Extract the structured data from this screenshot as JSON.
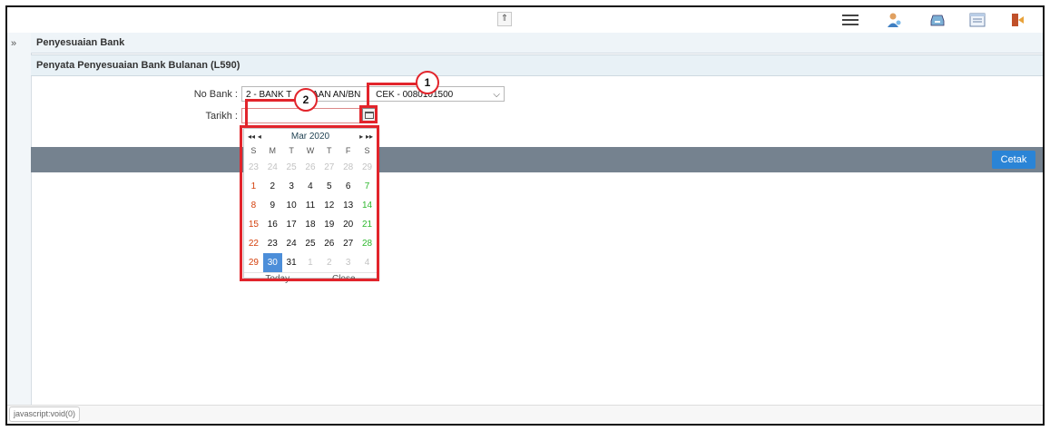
{
  "header": {
    "collapse_glyph": "⇑",
    "icons": [
      "menu-icon",
      "user-icon",
      "inbox-icon",
      "window-icon",
      "exit-icon"
    ]
  },
  "side_toggle_glyph": "»",
  "breadcrumb": {
    "title": "Penyesuaian Bank",
    "subtitle": "Penyata Penyesuaian Bank Bulanan (L590)"
  },
  "form": {
    "no_bank_label": "No Bank :",
    "no_bank_value": "2 - BANK T",
    "no_bank_value_tail": "AAN AN/BN",
    "no_bank_value_end": "CEK - 00801",
    "no_bank_value_last": "01500",
    "tarikh_label": "Tarikh :"
  },
  "action": {
    "cetak": "Cetak"
  },
  "calendar": {
    "month_label": "Mar 2020",
    "nav_prev_year": "◂◂",
    "nav_prev": "◂",
    "nav_next": "▸",
    "nav_next_year": "▸▸",
    "weekdays": [
      "S",
      "M",
      "T",
      "W",
      "T",
      "F",
      "S"
    ],
    "weeks": [
      [
        "23",
        "24",
        "25",
        "26",
        "27",
        "28",
        "29"
      ],
      [
        "1",
        "2",
        "3",
        "4",
        "5",
        "6",
        "7"
      ],
      [
        "8",
        "9",
        "10",
        "11",
        "12",
        "13",
        "14"
      ],
      [
        "15",
        "16",
        "17",
        "18",
        "19",
        "20",
        "21"
      ],
      [
        "22",
        "23",
        "24",
        "25",
        "26",
        "27",
        "28"
      ],
      [
        "29",
        "30",
        "31",
        "1",
        "2",
        "3",
        "4"
      ]
    ],
    "selected": "30",
    "today_label": "Today",
    "close_label": "Close"
  },
  "annotations": {
    "marker1": "1",
    "marker2": "2",
    "accent": "#e2242b"
  },
  "footer": {
    "chip": "javascript:void(0)"
  }
}
